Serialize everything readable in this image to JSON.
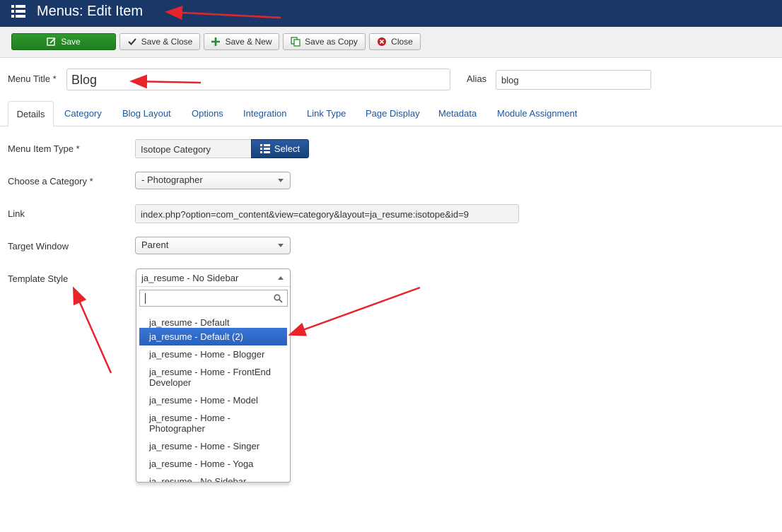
{
  "header": {
    "title": "Menus: Edit Item",
    "icon": "menu-grid-icon"
  },
  "toolbar": {
    "save": "Save",
    "save_close": "Save & Close",
    "save_new": "Save & New",
    "save_copy": "Save as Copy",
    "close": "Close"
  },
  "form": {
    "menu_title_label": "Menu Title *",
    "menu_title_value": "Blog",
    "alias_label": "Alias",
    "alias_value": "blog"
  },
  "tabs": [
    "Details",
    "Category",
    "Blog Layout",
    "Options",
    "Integration",
    "Link Type",
    "Page Display",
    "Metadata",
    "Module Assignment"
  ],
  "details": {
    "menu_item_type_label": "Menu Item Type *",
    "menu_item_type_value": "Isotope Category",
    "select_button": "Select",
    "category_label": "Choose a Category *",
    "category_value": "- Photographer",
    "link_label": "Link",
    "link_value": "index.php?option=com_content&view=category&layout=ja_resume:isotope&id=9",
    "target_label": "Target Window",
    "target_value": "Parent",
    "template_label": "Template Style",
    "template_value": "ja_resume - No Sidebar"
  },
  "dropdown": {
    "search_value": "",
    "options": [
      "ja_resume - Default",
      "ja_resume - Default (2)",
      "ja_resume - Home - Blogger",
      "ja_resume - Home - FrontEnd Developer",
      "ja_resume - Home - Model",
      "ja_resume - Home - Photographer",
      "ja_resume - Home - Singer",
      "ja_resume - Home - Yoga",
      "ja_resume - No Sidebar"
    ],
    "highlighted_index": 1
  },
  "colors": {
    "header_bg": "#1a3867",
    "save_green": "#2f9a2f",
    "select_blue": "#1f4f8f",
    "highlight": "#3875d7",
    "arrow_red": "#e8232a"
  }
}
